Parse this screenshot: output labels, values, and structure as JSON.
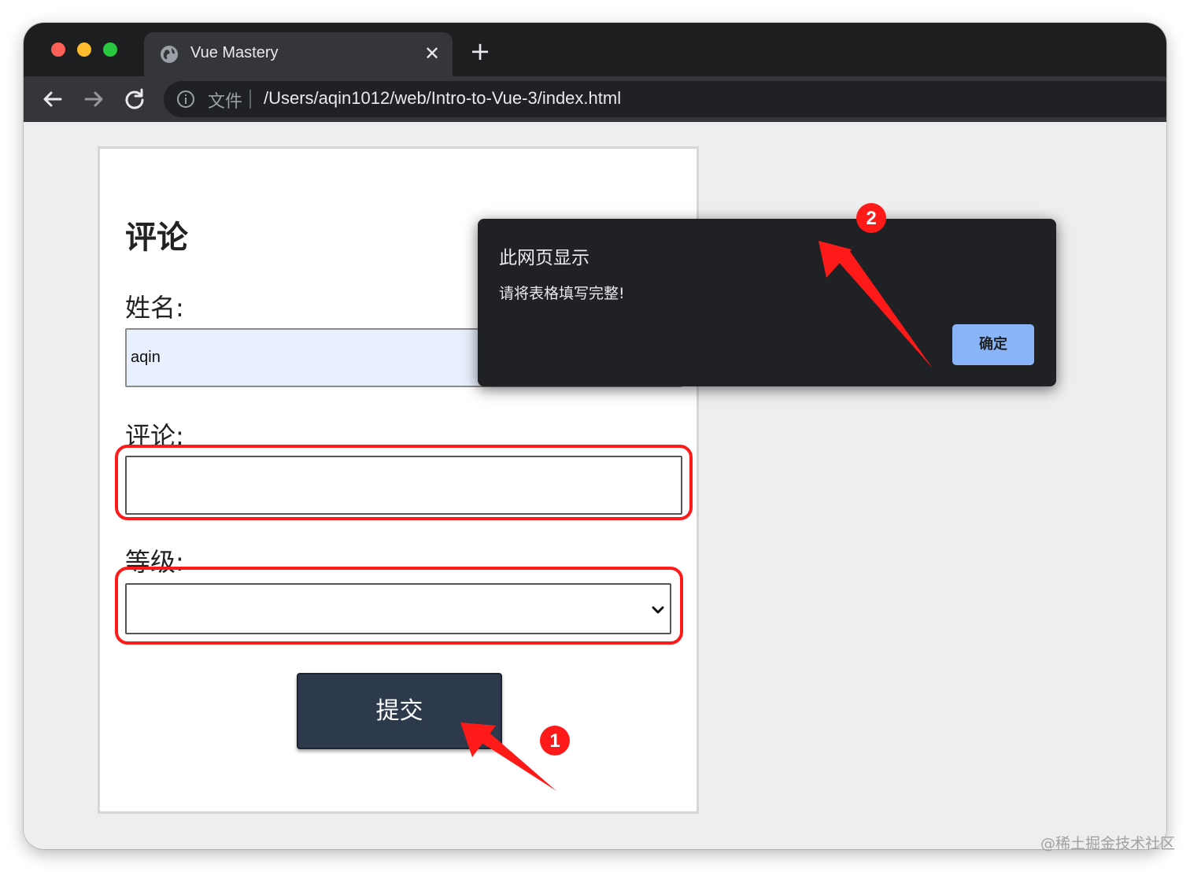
{
  "browser": {
    "tab_title": "Vue Mastery",
    "tab_close_glyph": "✕",
    "new_tab_glyph": "+",
    "scheme_label": "文件",
    "url": "/Users/aqin1012/web/Intro-to-Vue-3/index.html"
  },
  "form": {
    "title": "评论",
    "name_label": "姓名:",
    "name_value": "aqin",
    "review_label": "评论:",
    "review_value": "",
    "rating_label": "等级:",
    "rating_value": "",
    "submit_label": "提交"
  },
  "dialog": {
    "title": "此网页显示",
    "message": "请将表格填写完整!",
    "ok_label": "确定"
  },
  "annotations": {
    "badge_1": "1",
    "badge_2": "2",
    "highlight_color": "#ff1a1a"
  },
  "watermark": "@稀土掘金技术社区",
  "colors": {
    "tab_bar": "#1d1e20",
    "toolbar": "#35363a",
    "autofill_field": "#e8f0fe",
    "submit_button": "#2d3a4c",
    "dialog_bg": "#202124",
    "dialog_button": "#8ab4f8"
  },
  "icons": [
    "globe-icon",
    "close-icon",
    "plus-icon",
    "back-arrow-icon",
    "forward-arrow-icon",
    "reload-icon",
    "info-icon",
    "chevron-down-icon"
  ]
}
